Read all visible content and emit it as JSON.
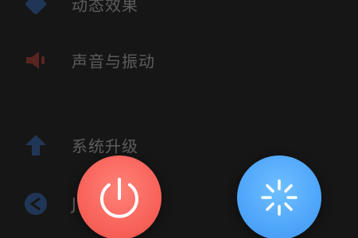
{
  "settings": {
    "items": [
      {
        "label": "动态效果",
        "icon": "animation-icon",
        "color": "#3a7bd5"
      },
      {
        "label": "声音与振动",
        "icon": "speaker-icon",
        "color": "#e0463c"
      },
      {
        "label": "系统升级",
        "icon": "upgrade-arrow-icon",
        "color": "#3a7bd5"
      },
      {
        "label": "J",
        "icon": "app-icon",
        "color": "#3a7bd5"
      }
    ]
  },
  "actions": {
    "power": {
      "icon": "power-icon",
      "color": "#f8635a"
    },
    "restart": {
      "icon": "restart-icon",
      "color": "#4fa6fa"
    }
  }
}
